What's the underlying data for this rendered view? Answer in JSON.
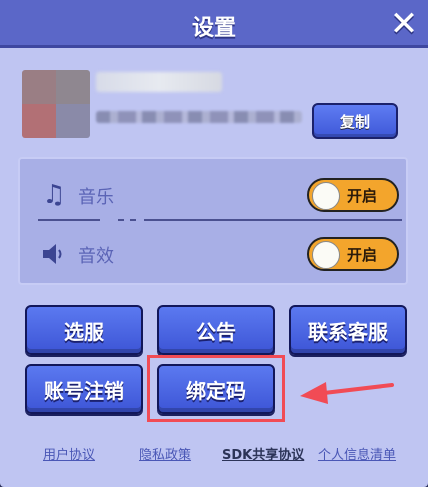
{
  "dialog": {
    "title": "设置",
    "close_icon": "close-icon"
  },
  "profile": {
    "copy_label": "复制"
  },
  "audio": {
    "music_label": "音乐",
    "music_toggle": "开启",
    "music_icon": "music-note-icon",
    "sound_label": "音效",
    "sound_toggle": "开启",
    "sound_icon": "speaker-icon"
  },
  "buttons": {
    "select_server": "选服",
    "announcement": "公告",
    "contact_support": "联系客服",
    "cancel_account": "账号注销",
    "bind_code": "绑定码"
  },
  "footer": {
    "user_agreement": "用户协议",
    "privacy_policy": "隐私政策",
    "sdk_sharing": "SDK共享协议",
    "personal_info": "个人信息清单"
  },
  "colors": {
    "accent": "#4a66e4",
    "toggle_on": "#f3a52c",
    "highlight": "#f14b55"
  }
}
